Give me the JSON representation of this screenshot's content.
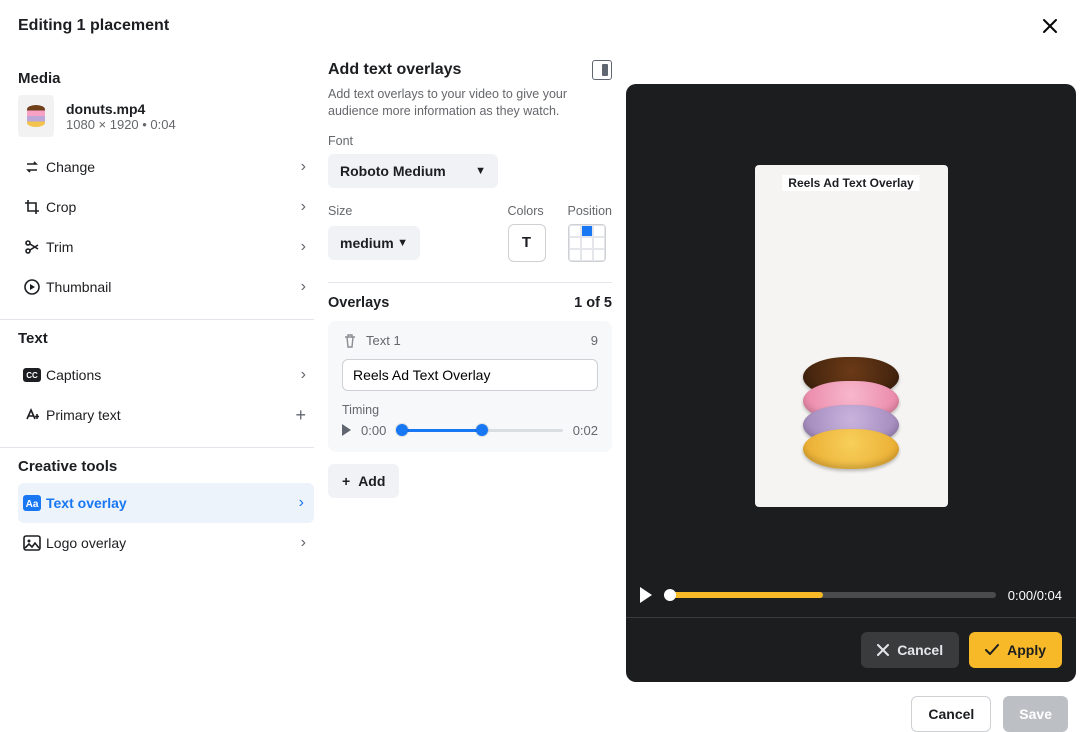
{
  "header": {
    "title": "Editing 1 placement"
  },
  "media": {
    "section": "Media",
    "filename": "donuts.mp4",
    "meta": "1080 × 1920 • 0:04",
    "items": {
      "change": "Change",
      "crop": "Crop",
      "trim": "Trim",
      "thumbnail": "Thumbnail"
    }
  },
  "text": {
    "section": "Text",
    "captions": "Captions",
    "primary_text": "Primary text"
  },
  "creative": {
    "section": "Creative tools",
    "text_overlay": "Text overlay",
    "logo_overlay": "Logo overlay"
  },
  "overlay_panel": {
    "title": "Add text overlays",
    "description": "Add text overlays to your video to give your audience more information as they watch.",
    "font_label": "Font",
    "font_value": "Roboto Medium",
    "size_label": "Size",
    "size_value": "medium",
    "colors_label": "Colors",
    "position_label": "Position",
    "overlays_label": "Overlays",
    "overlays_count": "1 of 5",
    "item_name": "Text 1",
    "char_count": "9",
    "text_value": "Reels Ad Text Overlay",
    "timing_label": "Timing",
    "start": "0:00",
    "end": "0:02",
    "add": "Add"
  },
  "preview": {
    "overlay_text": "Reels Ad Text Overlay",
    "time": "0:00/0:04",
    "cancel": "Cancel",
    "apply": "Apply"
  },
  "footer": {
    "cancel": "Cancel",
    "save": "Save"
  }
}
